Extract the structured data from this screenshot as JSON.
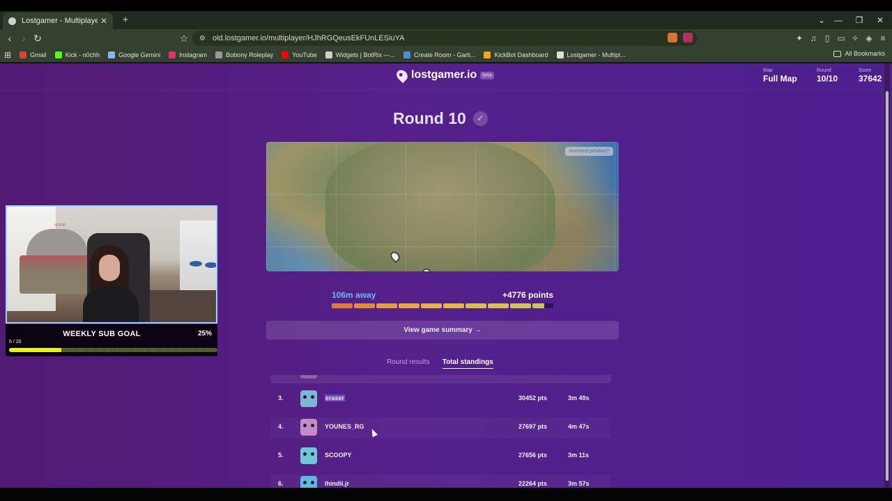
{
  "browser": {
    "tab_title": "Lostgamer - Multiplayer",
    "tab_close": "✕",
    "new_tab": "+",
    "url": "old.lostgamer.io/multiplayer/HJhRGQeusEkFUnLESiuYA",
    "window_controls": [
      "⌄",
      "—",
      "❐",
      "✕"
    ],
    "nav": {
      "back": "‹",
      "forward": "›",
      "reload": "↻",
      "bookmark": "☆"
    }
  },
  "bookmarks": [
    {
      "label": "Gmail",
      "color": "#d44638"
    },
    {
      "label": "Kick - n0chh",
      "color": "#53fc18"
    },
    {
      "label": "Google Gemini",
      "color": "#8ab4f8"
    },
    {
      "label": "Instagram",
      "color": "#e1306c"
    },
    {
      "label": "Bobony Roleplay",
      "color": "#9a9a9a"
    },
    {
      "label": "YouTube",
      "color": "#ff0000"
    },
    {
      "label": "Widgets | BotRix —...",
      "color": "#cfcfcf"
    },
    {
      "label": "Create Room - Garti...",
      "color": "#4a90d9"
    },
    {
      "label": "KickBot Dashboard",
      "color": "#f5a623"
    },
    {
      "label": "Lostgamer - Multipl...",
      "color": "#dddddd"
    }
  ],
  "all_bookmarks": "All Bookmarks",
  "app": {
    "logo": "lostgamer.io",
    "beta": "beta",
    "stats": [
      {
        "label": "Map",
        "value": "Full Map"
      },
      {
        "label": "Round",
        "value": "10/10"
      },
      {
        "label": "Score",
        "value": "37642"
      }
    ],
    "round_title": "Round 10",
    "incorrect_position": "Incorrect position?",
    "distance": "106m away",
    "points": "+4776 points",
    "score_fraction": 0.955,
    "view_summary": "View game summary  →",
    "tabs": [
      {
        "label": "Round results",
        "active": false
      },
      {
        "label": "Total standings",
        "active": true
      }
    ],
    "standings": [
      {
        "rank": "3.",
        "name": "eraser",
        "points": "30452 pts",
        "time": "3m 49s",
        "highlight": true,
        "color": "#7db7d6"
      },
      {
        "rank": "4.",
        "name": "YOUNES_RG",
        "points": "27697 pts",
        "time": "4m 47s",
        "highlight": false,
        "color": "#c78acb"
      },
      {
        "rank": "5.",
        "name": "SCOOPY",
        "points": "27656 pts",
        "time": "3m 11s",
        "highlight": false,
        "color": "#6fc6d6"
      },
      {
        "rank": "6.",
        "name": "lhindii.jr",
        "points": "22264 pts",
        "time": "3m 57s",
        "highlight": false,
        "color": "#5fb8e0"
      }
    ]
  },
  "stream": {
    "goal_title": "WEEKLY SUB GOAL",
    "goal_percent": "25%",
    "goal_count": "5 / 20",
    "goal_fraction": 0.25,
    "cam_tag": "n0chh"
  }
}
